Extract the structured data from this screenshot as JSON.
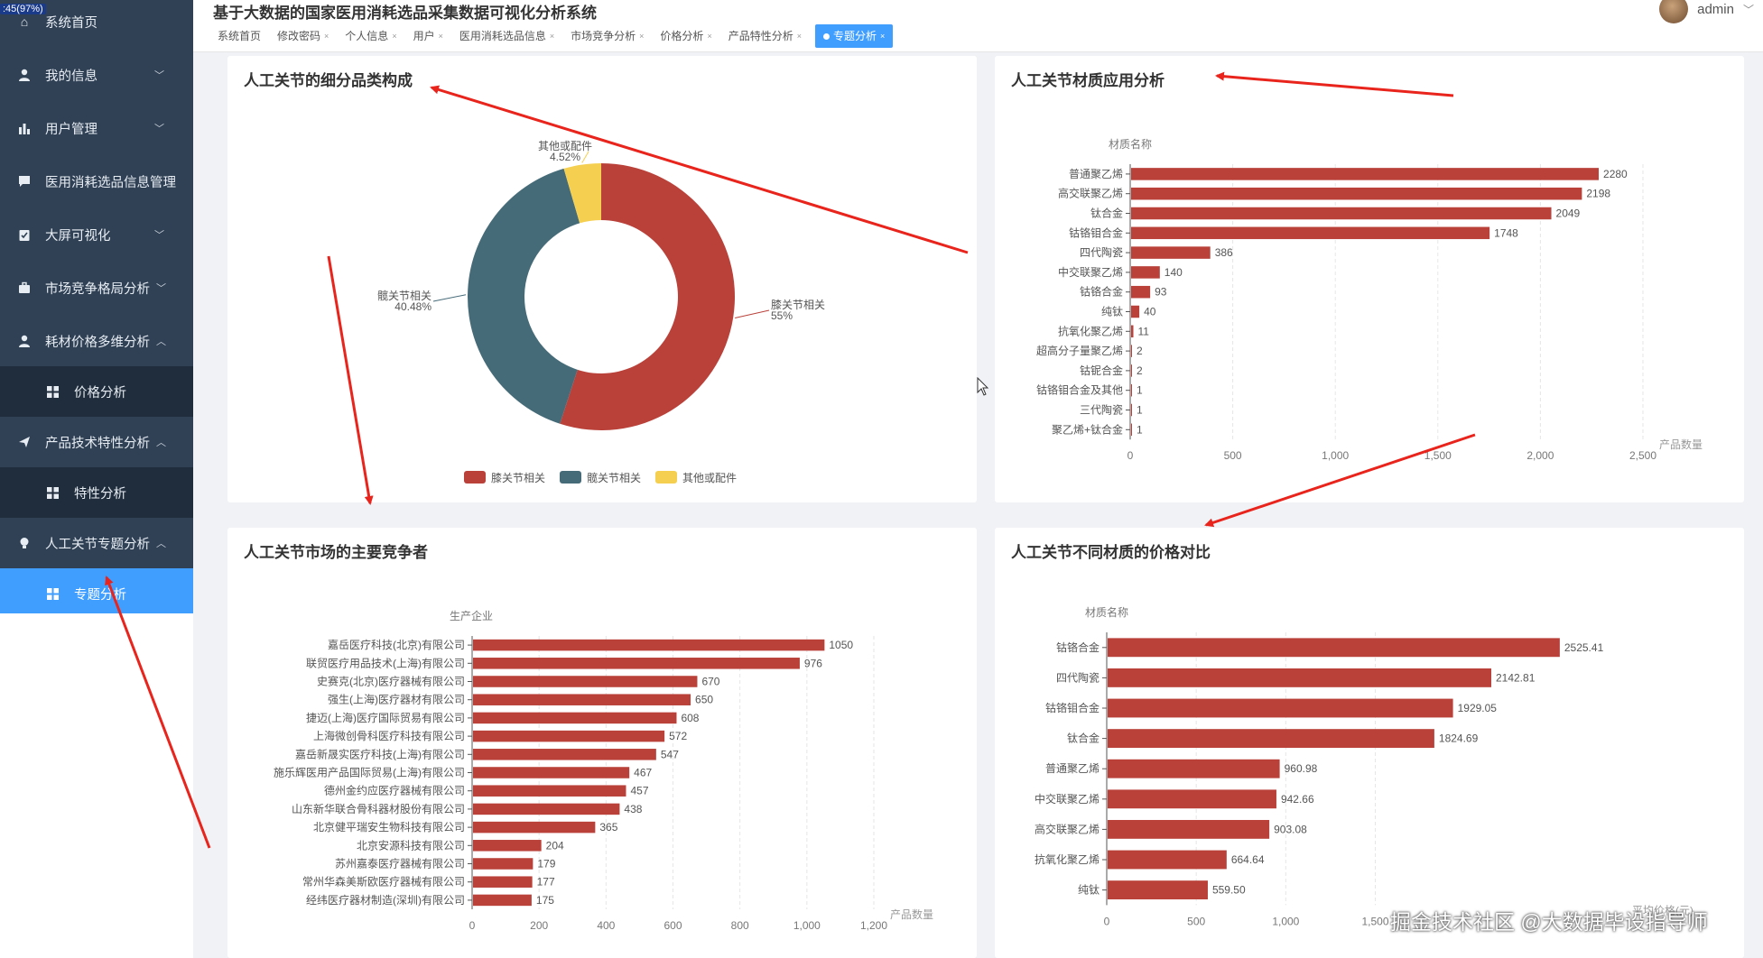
{
  "corner_badge": ":45(97%)",
  "app": {
    "title": "基于大数据的国家医用消耗选品采集数据可视化分析系统"
  },
  "user": {
    "name": "admin"
  },
  "sidebar": {
    "items": [
      {
        "label": "系统首页",
        "icon": "home-icon"
      },
      {
        "label": "我的信息",
        "icon": "user-icon"
      },
      {
        "label": "用户管理",
        "icon": "bar-chart-icon"
      },
      {
        "label": "医用消耗选品信息管理",
        "icon": "chat-icon"
      },
      {
        "label": "大屏可视化",
        "icon": "clipboard-icon"
      },
      {
        "label": "市场竞争格局分析",
        "icon": "briefcase-icon"
      },
      {
        "label": "耗材价格多维分析",
        "icon": "user-icon"
      },
      {
        "label": "价格分析",
        "icon": "grid-icon"
      },
      {
        "label": "产品技术特性分析",
        "icon": "send-icon"
      },
      {
        "label": "特性分析",
        "icon": "grid-icon"
      },
      {
        "label": "人工关节专题分析",
        "icon": "bulb-icon"
      },
      {
        "label": "专题分析",
        "icon": "grid-icon"
      }
    ]
  },
  "tabs": [
    "系统首页",
    "修改密码",
    "个人信息",
    "用户",
    "医用消耗选品信息",
    "市场竞争分析",
    "价格分析",
    "产品特性分析",
    "专题分析"
  ],
  "charts": {
    "pie": {
      "title": "人工关节的细分品类构成"
    },
    "material": {
      "title": "人工关节材质应用分析"
    },
    "competitor": {
      "title": "人工关节市场的主要竞争者"
    },
    "price": {
      "title": "人工关节不同材质的价格对比"
    }
  },
  "watermark": "掘金技术社区 @大数据毕设指导师",
  "colors": {
    "bar": "#b9413a",
    "pie": [
      "#b9413a",
      "#466b78",
      "#f5cf4f"
    ],
    "sidebar": "#304156",
    "active": "#409eff"
  },
  "chart_data": [
    {
      "type": "pie",
      "title": "人工关节的细分品类构成",
      "categories": [
        "膝关节相关",
        "髋关节相关",
        "其他或配件"
      ],
      "values": [
        55,
        40.48,
        4.52
      ],
      "value_labels": [
        "55%",
        "40.48%",
        "4.52%"
      ],
      "legend": "bottom"
    },
    {
      "type": "bar",
      "title": "人工关节材质应用分析",
      "ylabel": "材质名称",
      "xlabel": "产品数量",
      "categories": [
        "普通聚乙烯",
        "高交联聚乙烯",
        "钛合金",
        "钴铬钼合金",
        "四代陶瓷",
        "中交联聚乙烯",
        "钴铬合金",
        "纯钛",
        "抗氧化聚乙烯",
        "超高分子量聚乙烯",
        "钴铌合金",
        "钴铬钼合金及其他",
        "三代陶瓷",
        "聚乙烯+钛合金"
      ],
      "values": [
        2280,
        2198,
        2049,
        1748,
        386,
        140,
        93,
        40,
        11,
        2,
        2,
        1,
        1,
        1
      ],
      "xticks": [
        "0",
        "500",
        "1,000",
        "1,500",
        "2,000",
        "2,500"
      ],
      "xlim": [
        0,
        2500
      ]
    },
    {
      "type": "bar",
      "title": "人工关节市场的主要竞争者",
      "ylabel": "生产企业",
      "xlabel": "产品数量",
      "categories": [
        "嘉岳医疗科技(北京)有限公司",
        "联贸医疗用品技术(上海)有限公司",
        "史赛克(北京)医疗器械有限公司",
        "强生(上海)医疗器材有限公司",
        "捷迈(上海)医疗国际贸易有限公司",
        "上海微创骨科医疗科技有限公司",
        "嘉岳新晟实医疗科技(上海)有限公司",
        "施乐辉医用产品国际贸易(上海)有限公司",
        "德州金约应医疗器械有限公司",
        "山东新华联合骨科器材股份有限公司",
        "北京健平瑞安生物科技有限公司",
        "北京安源科技有限公司",
        "苏州嘉泰医疗器械有限公司",
        "常州华森美斯欧医疗器械有限公司",
        "经纬医疗器材制造(深圳)有限公司"
      ],
      "values": [
        1050,
        976,
        670,
        650,
        608,
        572,
        547,
        467,
        457,
        438,
        365,
        204,
        179,
        177,
        175
      ],
      "xticks": [
        "0",
        "200",
        "400",
        "600",
        "800",
        "1,000",
        "1,200"
      ],
      "xlim": [
        0,
        1200
      ]
    },
    {
      "type": "bar",
      "title": "人工关节不同材质的价格对比",
      "ylabel": "材质名称",
      "xlabel": "平均价格(元)",
      "categories": [
        "钴铬合金",
        "四代陶瓷",
        "钴铬钼合金",
        "钛合金",
        "普通聚乙烯",
        "中交联聚乙烯",
        "高交联聚乙烯",
        "抗氧化聚乙烯",
        "纯钛"
      ],
      "values": [
        2525.41,
        2142.81,
        1929.05,
        1824.69,
        960.98,
        942.66,
        903.08,
        664.64,
        559.5
      ],
      "value_labels": [
        "2525.41",
        "2142.81",
        "1929.05",
        "1824.69",
        "960.98",
        "942.66",
        "903.08",
        "664.64",
        "559.50"
      ],
      "xticks": [
        "0",
        "500",
        "1,000",
        "1,500"
      ],
      "xlim": [
        0,
        3000
      ]
    }
  ]
}
